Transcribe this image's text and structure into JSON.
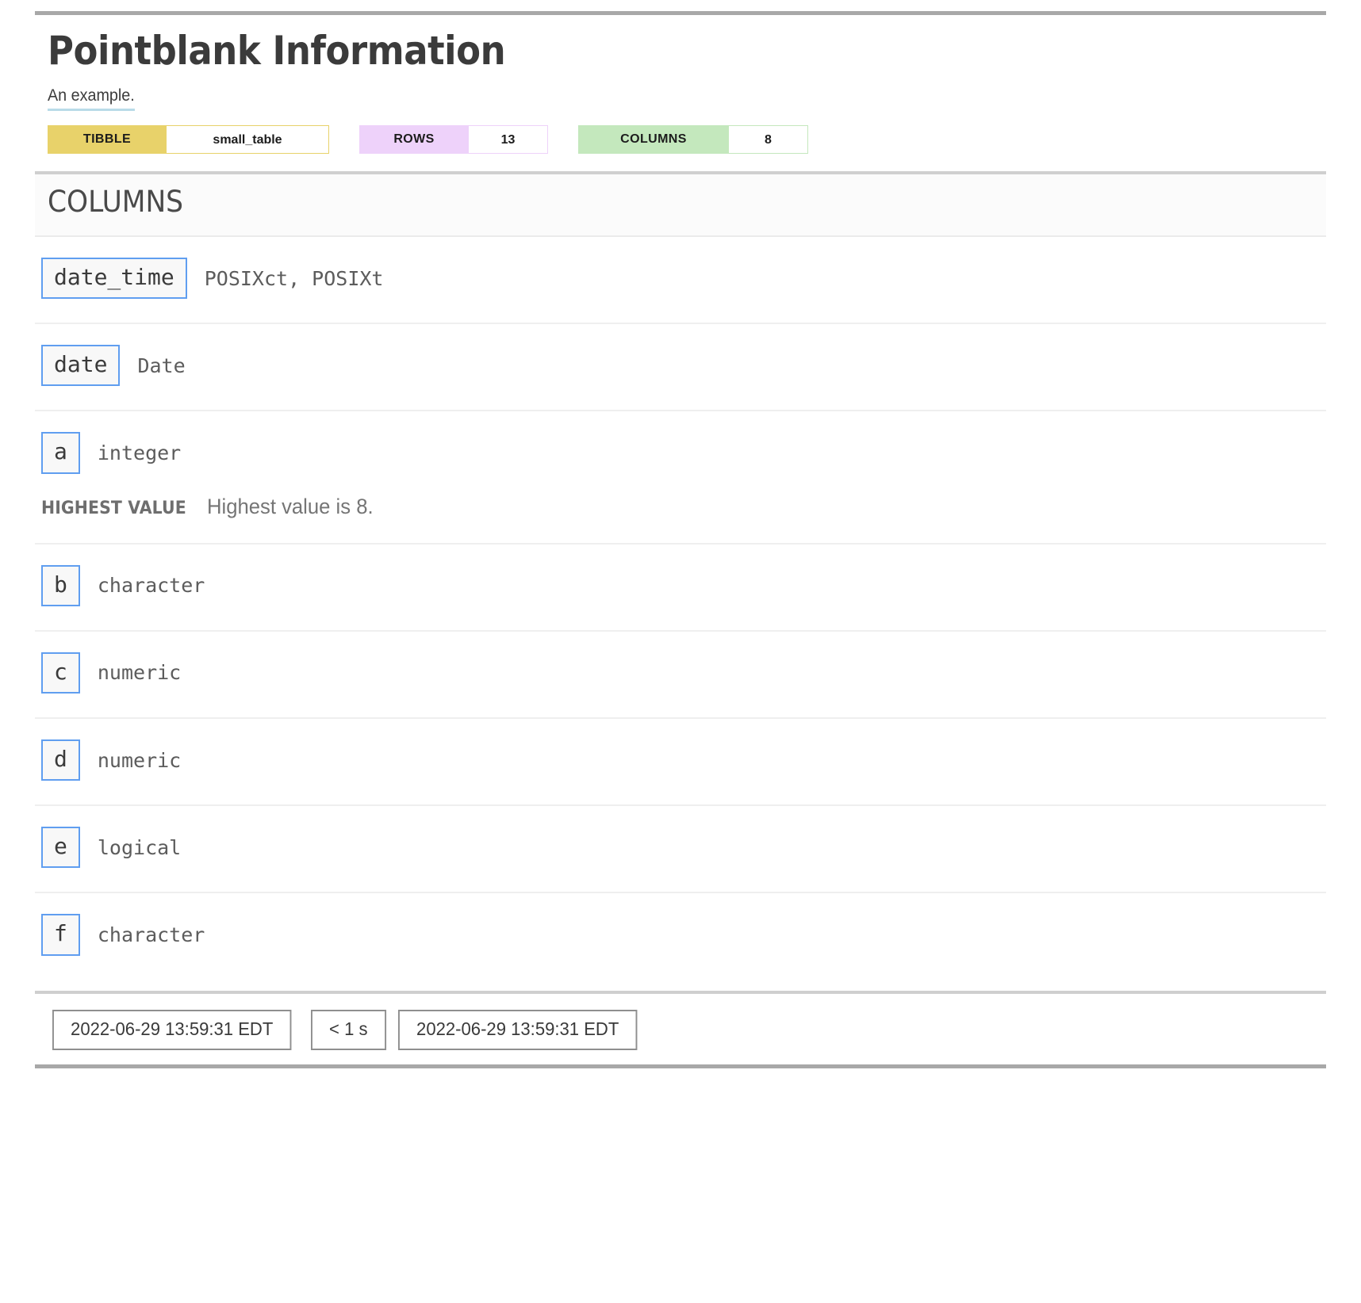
{
  "header": {
    "title": "Pointblank Information",
    "subtitle": "An example.",
    "badges": [
      {
        "key": "tibble",
        "label": "TIBBLE",
        "value": "small_table",
        "label_color": "#e8d26a"
      },
      {
        "key": "rows",
        "label": "ROWS",
        "value": "13",
        "label_color": "#eed2fa"
      },
      {
        "key": "columns",
        "label": "COLUMNS",
        "value": "8",
        "label_color": "#c4e8bd"
      }
    ]
  },
  "section": {
    "title": "COLUMNS"
  },
  "columns": [
    {
      "name": "date_time",
      "type": "POSIXct, POSIXt",
      "stat_label": null,
      "stat_text": null
    },
    {
      "name": "date",
      "type": "Date",
      "stat_label": null,
      "stat_text": null
    },
    {
      "name": "a",
      "type": "integer",
      "stat_label": "HIGHEST VALUE",
      "stat_text": "Highest value is 8."
    },
    {
      "name": "b",
      "type": "character",
      "stat_label": null,
      "stat_text": null
    },
    {
      "name": "c",
      "type": "numeric",
      "stat_label": null,
      "stat_text": null
    },
    {
      "name": "d",
      "type": "numeric",
      "stat_label": null,
      "stat_text": null
    },
    {
      "name": "e",
      "type": "logical",
      "stat_label": null,
      "stat_text": null
    },
    {
      "name": "f",
      "type": "character",
      "stat_label": null,
      "stat_text": null
    }
  ],
  "footer": {
    "start_time": "2022-06-29 13:59:31 EDT",
    "duration": "< 1 s",
    "end_time": "2022-06-29 13:59:31 EDT"
  }
}
